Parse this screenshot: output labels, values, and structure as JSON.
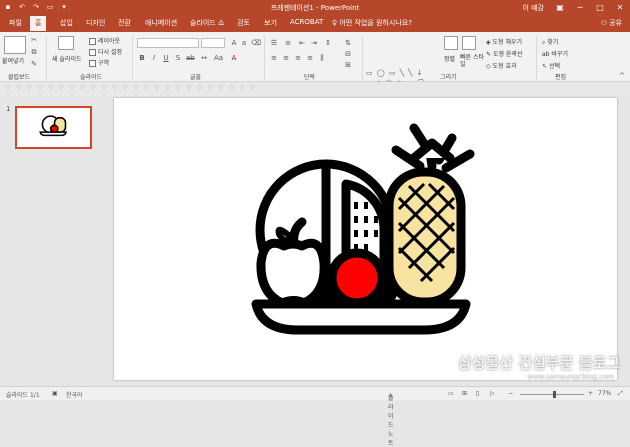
{
  "title_bar": {
    "window_title": "프레젠테이션1 - PowerPoint",
    "user": "이 예감",
    "controls": [
      "─",
      "□",
      "✕"
    ]
  },
  "tabs": [
    {
      "label": "파일"
    },
    {
      "label": "홈"
    },
    {
      "label": "삽입"
    },
    {
      "label": "디자인"
    },
    {
      "label": "전환"
    },
    {
      "label": "애니메이션"
    },
    {
      "label": "슬라이드 쇼"
    },
    {
      "label": "검토"
    },
    {
      "label": "보기"
    },
    {
      "label": "ACROBAT"
    }
  ],
  "tell_me": "♀ 어떤 작업을 원하시나요?",
  "share": "공유",
  "ribbon": {
    "clipboard": {
      "paste": "붙여넣기",
      "label": "클립보드"
    },
    "slides": {
      "new_slide": "새 슬라이드",
      "layout": "레이아웃",
      "reset": "다시 설정",
      "section": "구역",
      "label": "슬라이드"
    },
    "font": {
      "label": "글꼴"
    },
    "paragraph": {
      "label": "단락"
    },
    "drawing": {
      "arrange": "정렬",
      "quick_styles": "빠른 스타일",
      "fill": "도형 채우기",
      "outline": "도형 윤곽선",
      "effects": "도형 효과",
      "label": "그리기"
    },
    "editing": {
      "find": "찾기",
      "replace": "바꾸기",
      "select": "선택",
      "label": "편집"
    }
  },
  "slides_panel": {
    "slide_number": "1"
  },
  "status_bar": {
    "slide_info": "슬라이드 1/1",
    "language": "한국어",
    "notes": "슬라이드 노트",
    "zoom": "77%"
  },
  "zoom_level": 77,
  "watermark": {
    "text": "삼성물산 건설부문 블로그",
    "url": "www.samsungcblog.com"
  },
  "colors": {
    "accent": "#b7472a",
    "apple": "#ff0000",
    "pineapple": "#f9e3a0"
  }
}
